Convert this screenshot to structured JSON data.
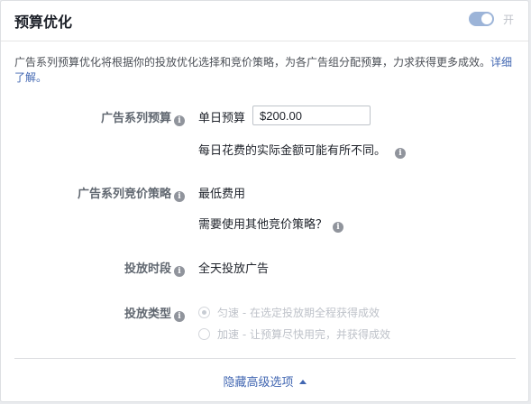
{
  "header": {
    "title": "预算优化",
    "toggle_label": "开"
  },
  "description": {
    "text": "广告系列预算优化将根据你的投放优化选择和竞价策略，为各广告组分配预算，力求获得更多成效。",
    "link": "详细了解。"
  },
  "budget": {
    "label": "广告系列预算",
    "type_label": "单日预算",
    "amount": "$200.00",
    "note": "每日花费的实际金额可能有所不同。"
  },
  "bid_strategy": {
    "label": "广告系列竞价策略",
    "value": "最低费用",
    "other_link": "需要使用其他竞价策略？"
  },
  "schedule": {
    "label": "投放时段",
    "value": "全天投放广告"
  },
  "delivery_type": {
    "label": "投放类型",
    "options": [
      {
        "name": "匀速",
        "desc": " - 在选定投放期全程获得成效",
        "checked": true
      },
      {
        "name": "加速",
        "desc": " - 让预算尽快用完，并获得成效",
        "checked": false
      }
    ]
  },
  "footer": {
    "hide_advanced": "隐藏高级选项"
  },
  "colors": {
    "link": "#4267b2",
    "toggle_on": "#9cb4d8"
  }
}
